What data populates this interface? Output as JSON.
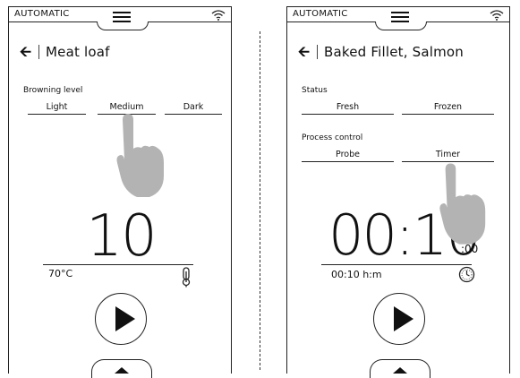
{
  "left_screen": {
    "mode": "AUTOMATIC",
    "title": "Meat loaf",
    "browning": {
      "label": "Browning level",
      "options": [
        "Light",
        "Medium",
        "Dark"
      ]
    },
    "value": "10",
    "temperature": "70°C",
    "icons": {
      "menu": "menu-icon",
      "wifi": "wifi-icon",
      "probe": "thermometer-probe-icon",
      "play": "play-icon"
    }
  },
  "right_screen": {
    "mode": "AUTOMATIC",
    "title": "Baked Fillet, Salmon",
    "status": {
      "label": "Status",
      "options": [
        "Fresh",
        "Frozen"
      ]
    },
    "process": {
      "label": "Process control",
      "options": [
        "Probe",
        "Timer"
      ]
    },
    "time_main": "00:10",
    "time_seconds": ":00",
    "time_text": "00:10 h:m",
    "icons": {
      "menu": "menu-icon",
      "wifi": "wifi-icon",
      "clock": "clock-icon",
      "play": "play-icon"
    }
  }
}
